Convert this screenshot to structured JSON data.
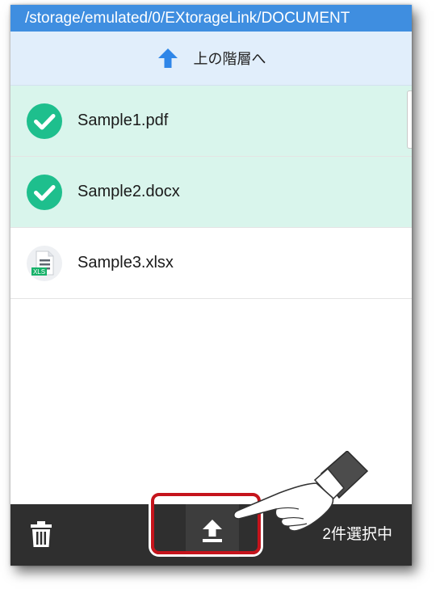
{
  "path_bar": {
    "path": "/storage/emulated/0/EXtorageLink/DOCUMENT"
  },
  "up_nav": {
    "label": "上の階層へ",
    "icon": "arrow-up-icon"
  },
  "files": [
    {
      "name": "Sample1.pdf",
      "selected": true,
      "icon": "check-circle-icon"
    },
    {
      "name": "Sample2.docx",
      "selected": true,
      "icon": "check-circle-icon"
    },
    {
      "name": "Sample3.xlsx",
      "selected": false,
      "icon": "xls-file-icon",
      "icon_badge": "XLS"
    }
  ],
  "toolbar": {
    "delete_icon": "trash-icon",
    "upload_icon": "upload-icon",
    "status": "2件選択中"
  },
  "colors": {
    "path_bar": "#3f8ee0",
    "up_bar": "#e1eefb",
    "selected_row": "#d9f5ec",
    "check": "#1ebf8d",
    "toolbar": "#2f2f2f",
    "highlight": "#c5141c"
  }
}
